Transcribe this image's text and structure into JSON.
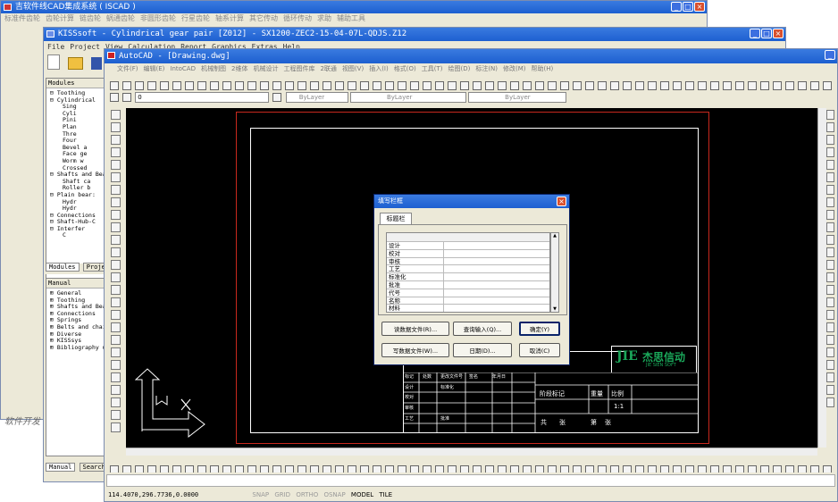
{
  "w1": {
    "title": "吉软件线CAD集成系统 ( ISCAD )",
    "menu": [
      "标准件齿轮",
      "齿轮计算",
      "链齿轮",
      "蜗通齿轮",
      "非圆形齿轮",
      "行星齿轮",
      "轴系计算",
      "其它传动",
      "循环传动",
      "求助",
      "辅助工具"
    ]
  },
  "w2": {
    "title": "KISSsoft - Cylindrical gear pair [Z012] - SX1200-ZEC2-15-04-07L-QDJS.Z12",
    "menu": [
      "File",
      "Project",
      "View",
      "Calculation",
      "Report",
      "Graphics",
      "Extras",
      "Help"
    ],
    "modules_header": "Modules",
    "tree": [
      "⊟ Toothing",
      "⊟ Cylindrical",
      "Sing",
      "Cyli",
      "Pini",
      "Plan",
      "Thre",
      "Four",
      "Bevel a",
      "Face ge",
      "Worm w",
      "Crossed",
      "⊟ Shafts and Bear",
      "Shaft ca",
      "Roller b",
      "⊟ Plain bear:",
      "Hydr",
      "Hydr",
      "⊟ Connections",
      "⊟ Shaft-Hub-C",
      "⊟ Interfer",
      "C"
    ],
    "tabs": [
      "Modules",
      "Projec"
    ],
    "manual_header": "Manual",
    "manual_items": [
      "⊞ General",
      "⊞ Toothing",
      "⊞ Shafts and Bea",
      "⊞ Connections",
      "⊞ Springs",
      "⊞ Belts and chai",
      "⊞ Diverse",
      "⊞ KISSsys",
      "⊞ Bibliography u"
    ],
    "bottom_tabs": [
      "Manual",
      "Search"
    ],
    "side_text": "软件开发"
  },
  "w3": {
    "title": "AutoCAD - [Drawing.dwg]",
    "menu": [
      "文件(F)",
      "编辑(E)",
      "IntoCAD",
      "机械制图",
      "2维体",
      "机械设计",
      "工程图件库",
      "2联通",
      "视图(V)",
      "插入(I)",
      "格式(O)",
      "工具(T)",
      "绘图(D)",
      "标注(N)",
      "修改(M)",
      "帮助(H)"
    ],
    "layer_name": "0",
    "bylayer1": "ByLayer",
    "bylayer2": "ByLayer",
    "bylayer3": "ByLayer",
    "status_coords": "114.4070,296.7736,0.0000",
    "status_modes": [
      "SNAP",
      "GRID",
      "ORTHO",
      "OSNAP",
      "MODEL",
      "TILE"
    ]
  },
  "dialog": {
    "title": "填写栏框",
    "tab": "标题栏",
    "rows": [
      "设计",
      "校对",
      "审核",
      "工艺",
      "标准化",
      "批准",
      "代号",
      "名称",
      "材料"
    ],
    "buttons": {
      "read_file": "读数据文件(R)...",
      "query_input": "查询输入(Q)...",
      "ok": "确定(Y)",
      "write_file": "写数据文件(W)...",
      "date": "日期(D)...",
      "cancel": "取消(C)"
    }
  },
  "titleblock": {
    "logo_text": "杰思信动",
    "logo_sub": "JIE SIEN SOFT",
    "header_row": [
      "标记",
      "处数",
      "更改文件号",
      "签名",
      "年月日"
    ],
    "labels": [
      "设计",
      "标准化",
      "校对",
      "审核",
      "工艺",
      "批准"
    ],
    "right_headers": [
      "阶段标记",
      "重量",
      "比例"
    ],
    "scale_value": "1:1",
    "sheet_text": [
      "共",
      "张",
      "第",
      "张"
    ]
  },
  "colors": {
    "xp_blue": "#1d5fd0",
    "cad_bg": "#000000",
    "frame_red": "#c8281e",
    "dialog_bg": "#ece9d8"
  }
}
